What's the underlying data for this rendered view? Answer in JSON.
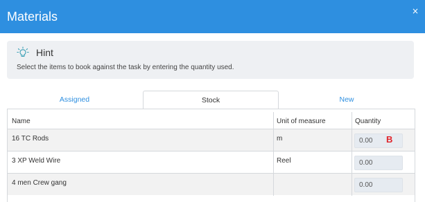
{
  "dialog": {
    "title": "Materials",
    "close_glyph": "×"
  },
  "hint": {
    "icon": "lightbulb-icon",
    "title": "Hint",
    "text": "Select the items to book against the task by entering the quantity used."
  },
  "tabs": [
    {
      "label": "Assigned",
      "active": false
    },
    {
      "label": "Stock",
      "active": true
    },
    {
      "label": "New",
      "active": false
    }
  ],
  "table": {
    "columns": [
      "Name",
      "Unit of measure",
      "Quantity"
    ],
    "rows": [
      {
        "name": "16 TC Rods",
        "unit": "m",
        "quantity": "0.00",
        "badge": "B"
      },
      {
        "name": "3 XP Weld Wire",
        "unit": "Reel",
        "quantity": "0.00"
      },
      {
        "name": "4 men Crew gang",
        "unit": "",
        "quantity": "0.00"
      }
    ]
  },
  "colors": {
    "header": "#2e8fe0",
    "tab_link": "#2e8fe0",
    "badge": "#e0242a"
  }
}
